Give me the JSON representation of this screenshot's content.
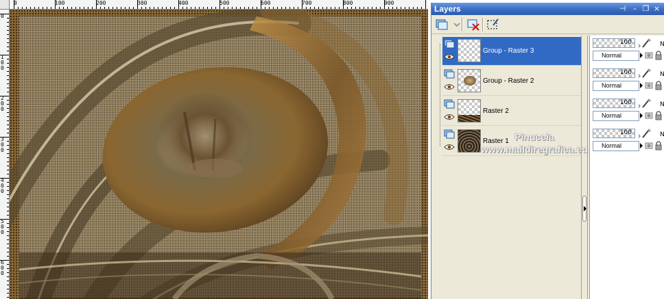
{
  "rulers": {
    "top_labels": [
      "0",
      "100",
      "200",
      "300",
      "400",
      "500",
      "600",
      "700",
      "800",
      "900"
    ],
    "left_labels": [
      "0",
      "100",
      "200",
      "300",
      "400",
      "500",
      "600"
    ]
  },
  "palette": {
    "title": "Layers",
    "title_buttons": [
      "⊣",
      "–",
      "❐",
      "×"
    ]
  },
  "layers": [
    {
      "name": "Group - Raster 3",
      "selected": true,
      "opacity": "100",
      "blend": "Normal"
    },
    {
      "name": "Group - Raster 2",
      "selected": false,
      "opacity": "100",
      "blend": "Normal"
    },
    {
      "name": "Raster 2",
      "selected": false,
      "opacity": "100",
      "blend": "Normal"
    },
    {
      "name": "Raster 1",
      "selected": false,
      "opacity": "100",
      "blend": "Normal"
    }
  ],
  "props_extra_letter": "N",
  "watermark": {
    "line1": "Pinuccia",
    "line2": "www.maildiregrafica.eu"
  },
  "colors": {
    "selection": "#316ac5",
    "titlebar": "#3d6fc4",
    "palette_bg": "#ece9d8",
    "image_gold": "#a87a3a"
  }
}
